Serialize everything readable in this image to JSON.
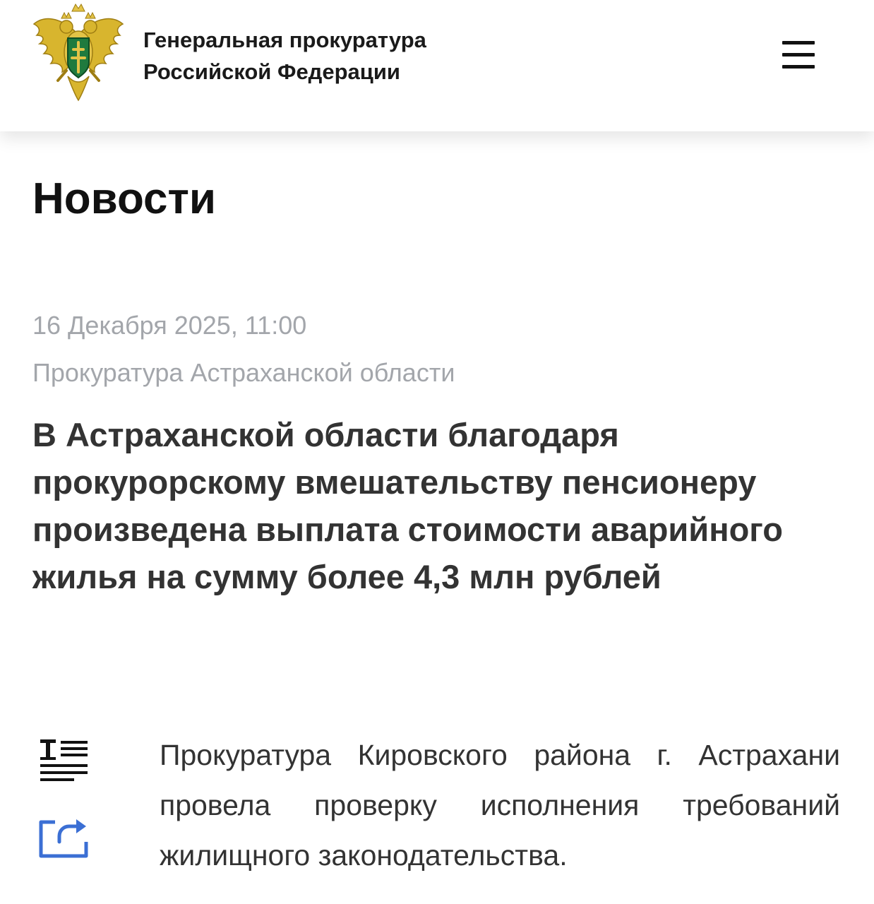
{
  "header": {
    "emblem_icon": "double-headed-eagle-emblem",
    "org_line1": "Генеральная прокуратура",
    "org_line2": "Российской Федерации",
    "menu_icon": "hamburger-menu-icon"
  },
  "page": {
    "title": "Новости"
  },
  "article": {
    "date": "16 Декабря 2025, 11:00",
    "source": "Прокуратура Астраханской области",
    "headline_lines": [
      "В Астраханской области благодаря",
      "прокурорскому вмешательству пенсионеру",
      "произведена выплата стоимости аварийного",
      "жилья на сумму более 4,3 млн рублей"
    ],
    "body": "Прокуратура Кировского района г. Астрахани провела проверку исполнения требований жилищного законодательства."
  },
  "tools": {
    "text_icon": "text-size-icon",
    "share_icon": "share-icon"
  },
  "colors": {
    "muted_text": "#a3a6ab",
    "headline_text": "#333333",
    "share_icon_blue": "#3b6fd4",
    "emblem_gold": "#d8b52e",
    "emblem_green": "#1f7a3e"
  }
}
